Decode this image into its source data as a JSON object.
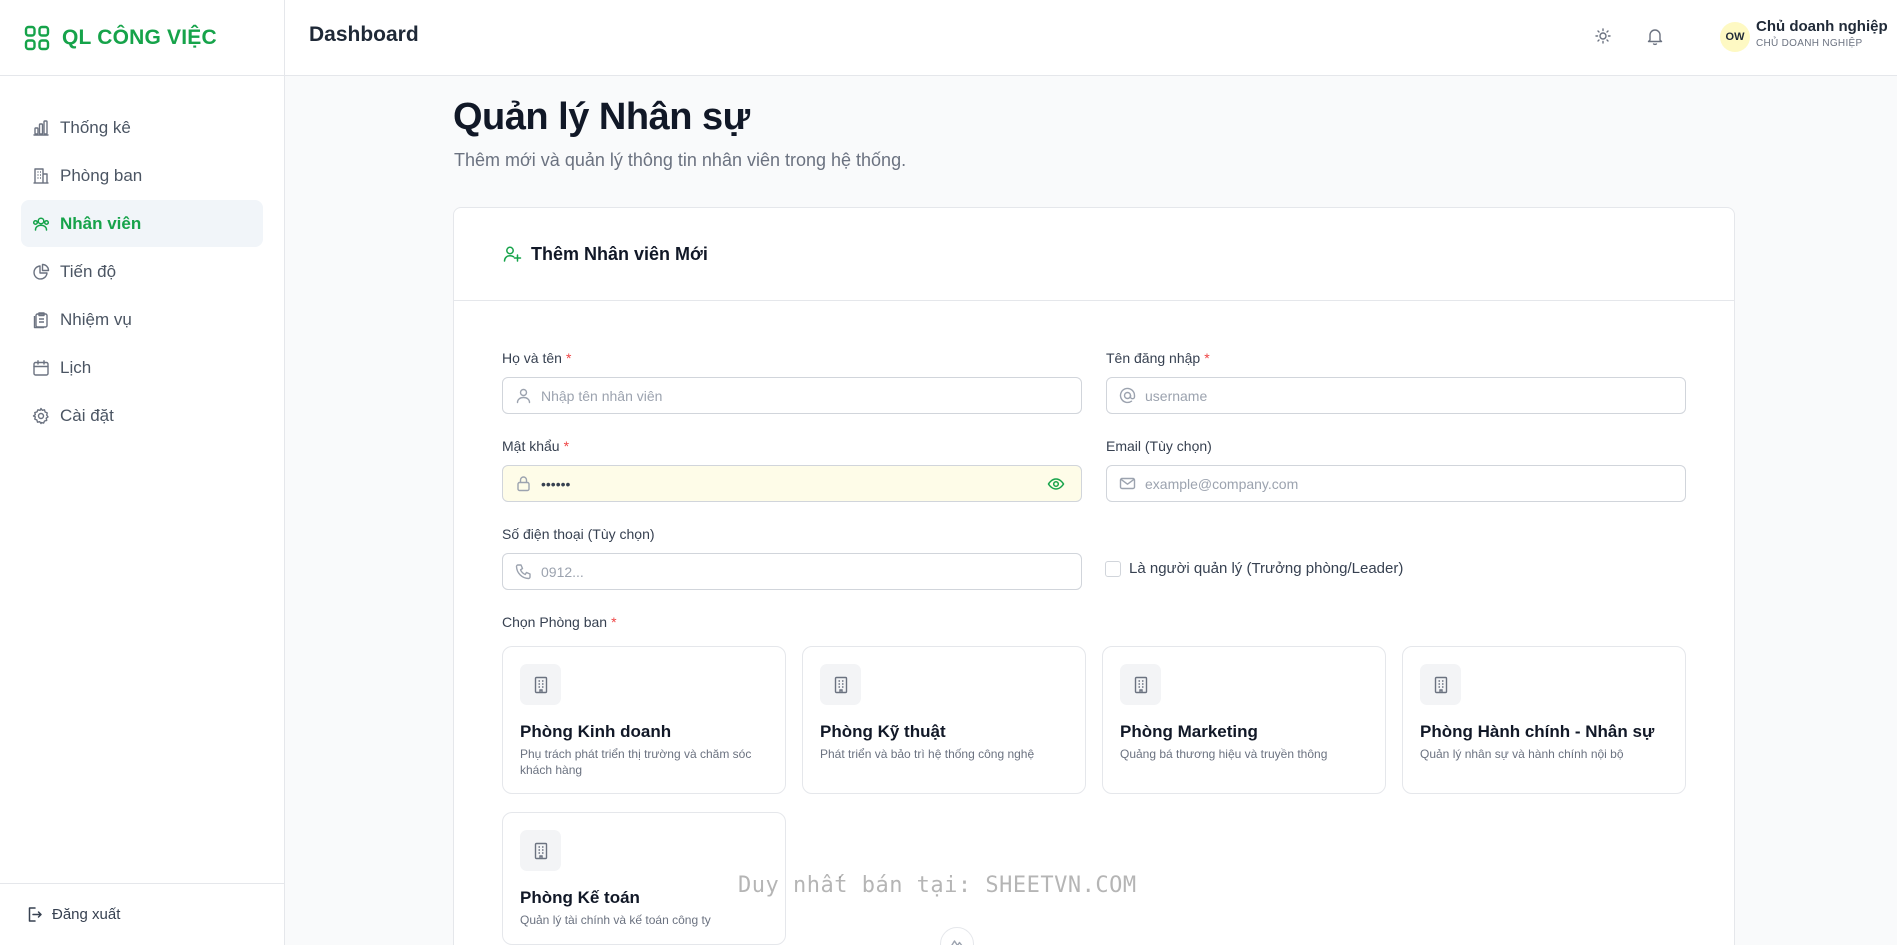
{
  "brand": {
    "name": "QL CÔNG VIỆC",
    "icon": "grid-icon"
  },
  "sidebar": {
    "items": [
      {
        "label": "Thống kê",
        "icon": "bar-chart-icon",
        "active": false
      },
      {
        "label": "Phòng ban",
        "icon": "building-icon",
        "active": false
      },
      {
        "label": "Nhân viên",
        "icon": "users-icon",
        "active": true
      },
      {
        "label": "Tiến độ",
        "icon": "pie-chart-icon",
        "active": false
      },
      {
        "label": "Nhiệm vụ",
        "icon": "clipboard-icon",
        "active": false
      },
      {
        "label": "Lịch",
        "icon": "calendar-icon",
        "active": false
      },
      {
        "label": "Cài đặt",
        "icon": "gear-icon",
        "active": false
      }
    ],
    "logout_label": "Đăng xuất"
  },
  "header": {
    "title": "Dashboard",
    "user": {
      "initials": "OW",
      "name": "Chủ doanh nghiệp",
      "role": "CHỦ DOANH NGHIỆP"
    }
  },
  "page": {
    "title": "Quản lý Nhân sự",
    "subtitle": "Thêm mới và quản lý thông tin nhân viên trong hệ thống."
  },
  "form": {
    "title": "Thêm Nhân viên Mới",
    "required_mark": "*",
    "fields": {
      "fullname": {
        "label": "Họ và tên",
        "placeholder": "Nhập tên nhân viên",
        "value": ""
      },
      "username": {
        "label": "Tên đăng nhập",
        "placeholder": "username",
        "value": ""
      },
      "password": {
        "label": "Mật khẩu",
        "placeholder": "",
        "value": "••••••"
      },
      "email": {
        "label": "Email (Tùy chọn)",
        "placeholder": "example@company.com",
        "value": ""
      },
      "phone": {
        "label": "Số điện thoại (Tùy chọn)",
        "placeholder": "0912...",
        "value": ""
      }
    },
    "manager_checkbox_label": "Là người quản lý (Trưởng phòng/Leader)",
    "manager_checked": false,
    "department_label": "Chọn Phòng ban",
    "departments": [
      {
        "name": "Phòng Kinh doanh",
        "desc": "Phụ trách phát triển thị trường và chăm sóc khách hàng"
      },
      {
        "name": "Phòng Kỹ thuật",
        "desc": "Phát triển và bảo trì hệ thống công nghệ"
      },
      {
        "name": "Phòng Marketing",
        "desc": "Quảng bá thương hiệu và truyền thông"
      },
      {
        "name": "Phòng Hành chính - Nhân sự",
        "desc": "Quản lý nhân sự và hành chính nội bộ"
      },
      {
        "name": "Phòng Kế toán",
        "desc": "Quản lý tài chính và kế toán công ty"
      }
    ]
  },
  "watermark": "Duy nhất bán tại: SHEETVN.COM",
  "colors": {
    "accent": "#16a34a",
    "required": "#ef4444",
    "active_bg": "#f1f5f9"
  }
}
